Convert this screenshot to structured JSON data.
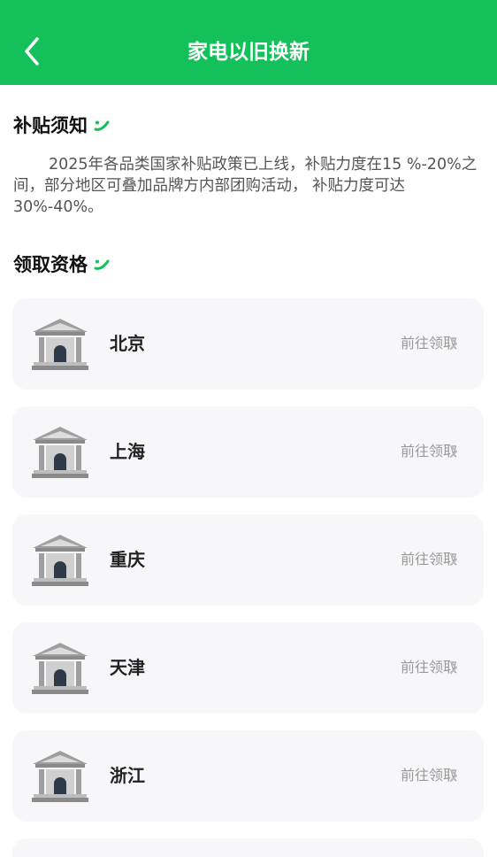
{
  "header": {
    "title": "家电以旧换新"
  },
  "notice": {
    "heading": "补贴须知",
    "body": "2025年各品类国家补贴政策已上线，补贴力度在15 %-20%之间，部分地区可叠加品牌方内部团购活动， 补贴力度可达30%-40%。"
  },
  "eligibility": {
    "heading": "领取资格"
  },
  "cards": [
    {
      "city": "北京",
      "action": "前往领取"
    },
    {
      "city": "上海",
      "action": "前往领取"
    },
    {
      "city": "重庆",
      "action": "前往领取"
    },
    {
      "city": "天津",
      "action": "前往领取"
    },
    {
      "city": "浙江",
      "action": "前往领取"
    }
  ],
  "colors": {
    "brand_green": "#13c05a",
    "card_bg": "#f7f7f9"
  },
  "icons": {
    "back": "chevron-left-icon",
    "card": "government-building-icon",
    "arrow": "chevron-right-icon",
    "deco": "green-swirl-icon"
  }
}
